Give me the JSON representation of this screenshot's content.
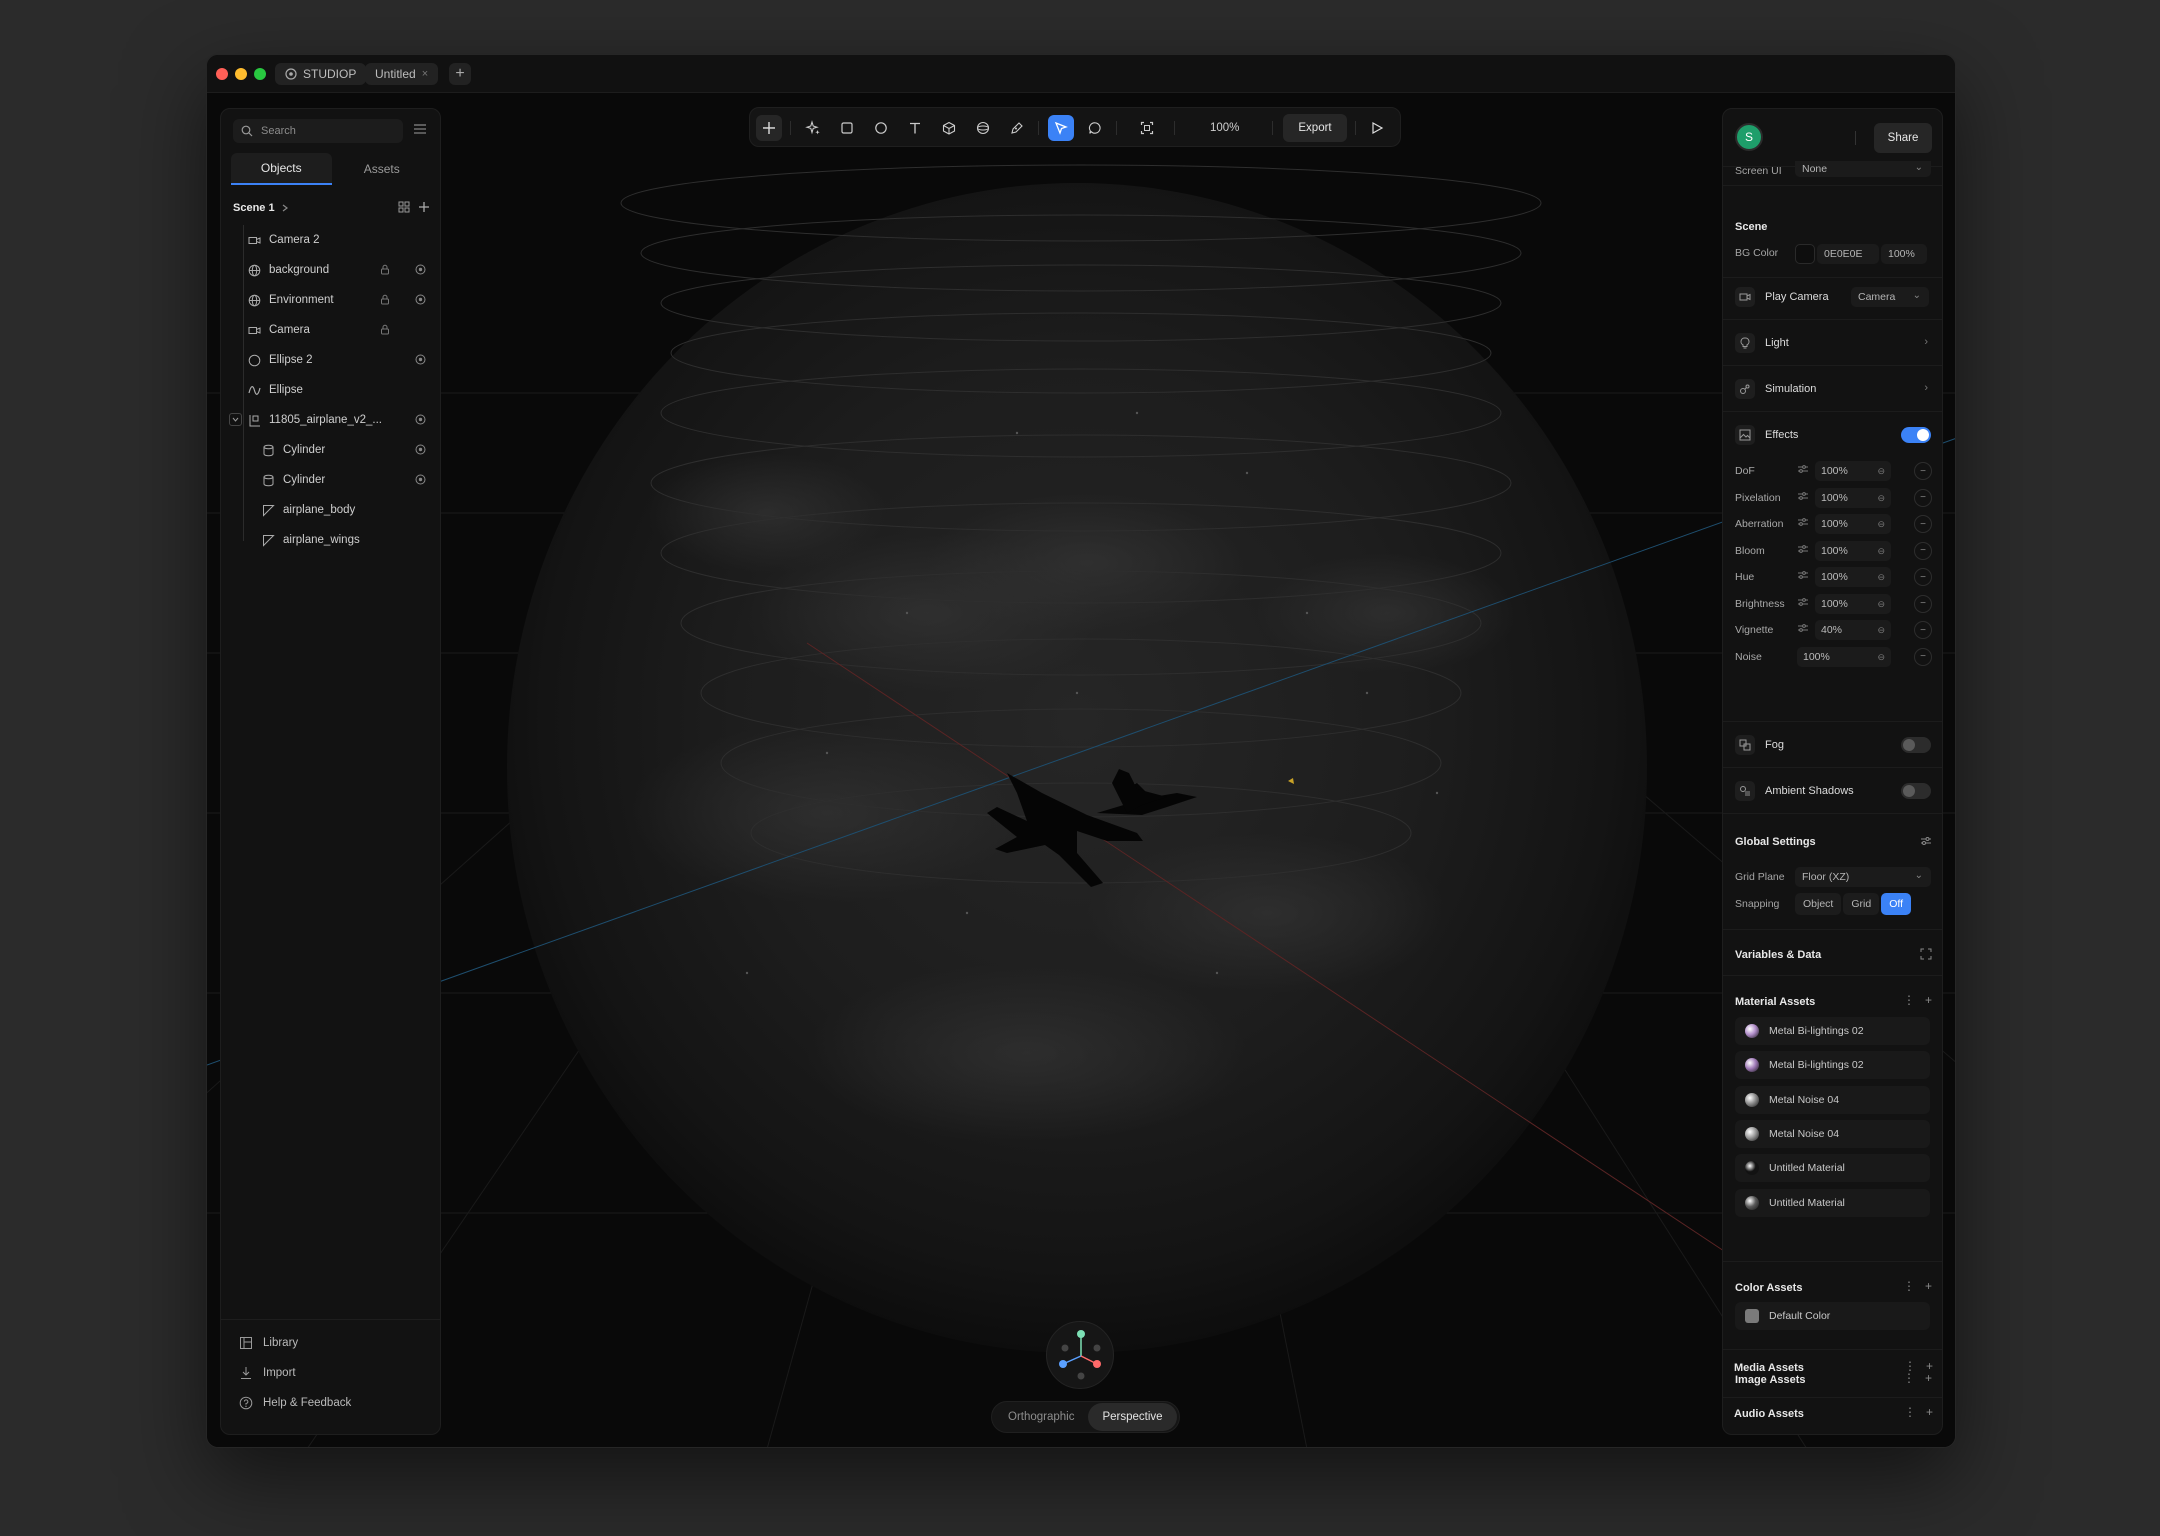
{
  "titlebar": {
    "app_name": "STUDIOP",
    "doc_tab": "Untitled",
    "close_glyph": "×",
    "add_glyph": "+"
  },
  "left_panel": {
    "search_placeholder": "Search",
    "tabs": [
      {
        "label": "Objects",
        "active": true
      },
      {
        "label": "Assets",
        "active": false
      }
    ],
    "scene_name": "Scene 1",
    "tree": [
      {
        "label": "Camera 2",
        "icon": "camera-icon",
        "level": 0,
        "lock": false,
        "eye": false
      },
      {
        "label": "background",
        "icon": "globe-icon",
        "level": 0,
        "lock": true,
        "eye": true
      },
      {
        "label": "Environment",
        "icon": "globe-icon",
        "level": 0,
        "lock": true,
        "eye": true
      },
      {
        "label": "Camera",
        "icon": "camera-icon",
        "level": 0,
        "lock": true,
        "eye": false
      },
      {
        "label": "Ellipse 2",
        "icon": "circle-icon",
        "level": 0,
        "lock": false,
        "eye": true
      },
      {
        "label": "Ellipse",
        "icon": "path-icon",
        "level": 0,
        "lock": false,
        "eye": false
      },
      {
        "label": "11805_airplane_v2_...",
        "icon": "group-icon",
        "level": 0,
        "lock": false,
        "eye": true
      },
      {
        "label": "Cylinder",
        "icon": "cylinder-icon",
        "level": 1,
        "lock": false,
        "eye": true
      },
      {
        "label": "Cylinder",
        "icon": "cylinder-icon",
        "level": 1,
        "lock": false,
        "eye": true
      },
      {
        "label": "airplane_body",
        "icon": "mesh-icon",
        "level": 1,
        "lock": false,
        "eye": false
      },
      {
        "label": "airplane_wings",
        "icon": "mesh-icon",
        "level": 1,
        "lock": false,
        "eye": false
      }
    ],
    "footer": [
      {
        "label": "Library",
        "icon": "library-icon"
      },
      {
        "label": "Import",
        "icon": "import-icon"
      },
      {
        "label": "Help & Feedback",
        "icon": "help-icon"
      }
    ]
  },
  "toolbar": {
    "zoom": "100%",
    "export_label": "Export"
  },
  "viewport": {
    "view_modes": [
      {
        "label": "Orthographic",
        "active": false
      },
      {
        "label": "Perspective",
        "active": true
      }
    ]
  },
  "right_panel": {
    "avatar_initial": "S",
    "share_label": "Share",
    "screen_ui_label": "Screen UI",
    "screen_ui_value": "None",
    "scene_title": "Scene",
    "bg_color_label": "BG Color",
    "bg_color_hex": "0E0E0E",
    "bg_color_opacity": "100%",
    "play_camera_label": "Play Camera",
    "play_camera_value": "Camera",
    "light_label": "Light",
    "simulation_label": "Simulation",
    "effects_label": "Effects",
    "effects": [
      {
        "name": "DoF",
        "value": "100%"
      },
      {
        "name": "Pixelation",
        "value": "100%"
      },
      {
        "name": "Aberration",
        "value": "100%"
      },
      {
        "name": "Bloom",
        "value": "100%"
      },
      {
        "name": "Hue",
        "value": "100%"
      },
      {
        "name": "Brightness",
        "value": "100%"
      },
      {
        "name": "Vignette",
        "value": "40%"
      },
      {
        "name": "Noise",
        "value": "100%"
      }
    ],
    "fog_label": "Fog",
    "ambient_shadows_label": "Ambient Shadows",
    "global_settings_title": "Global Settings",
    "grid_plane_label": "Grid Plane",
    "grid_plane_value": "Floor (XZ)",
    "snapping_label": "Snapping",
    "snapping_options": [
      {
        "label": "Object",
        "active": false
      },
      {
        "label": "Grid",
        "active": false
      },
      {
        "label": "Off",
        "active": true
      }
    ],
    "variables_title": "Variables & Data",
    "material_assets_title": "Material Assets",
    "materials": [
      {
        "label": "Metal Bi-lightings 02",
        "color": "#b08cc8"
      },
      {
        "label": "Metal Bi-lightings 02",
        "color": "#a07ab8"
      },
      {
        "label": "Metal Noise 04",
        "color": "#8f8f8f"
      },
      {
        "label": "Metal Noise 04",
        "color": "#9a9a9a"
      },
      {
        "label": "Untitled Material",
        "color": "#121212"
      },
      {
        "label": "Untitled Material",
        "color": "#5a5a5a"
      }
    ],
    "color_assets_title": "Color Assets",
    "colors": [
      {
        "label": "Default Color",
        "color": "#7a7a7a"
      }
    ],
    "image_assets_title": "Image Assets",
    "media_assets_title": "Media Assets",
    "audio_assets_title": "Audio Assets"
  },
  "colors": {
    "accent": "#3b82f6",
    "close_dot": "#ff5f57",
    "min_dot": "#febc2e",
    "max_dot": "#28c840",
    "avatar": "#1e9e6a"
  }
}
